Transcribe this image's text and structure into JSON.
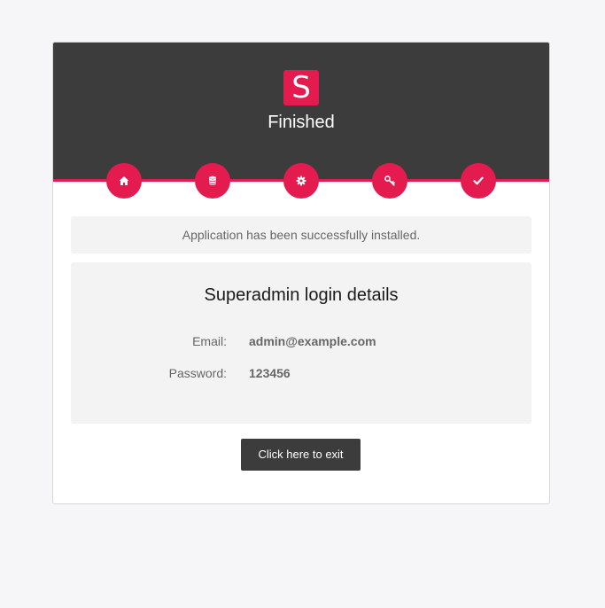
{
  "header": {
    "logo_letter": "S",
    "title": "Finished",
    "accent_color": "#e31b4e",
    "background_color": "#3c3c3c"
  },
  "steps": [
    {
      "icon": "home-icon",
      "completed": true
    },
    {
      "icon": "database-icon",
      "completed": true
    },
    {
      "icon": "gear-icon",
      "completed": true
    },
    {
      "icon": "key-icon",
      "completed": true
    },
    {
      "icon": "check-icon",
      "completed": true
    }
  ],
  "notice": {
    "text": "Application has been successfully installed."
  },
  "login_details": {
    "title": "Superadmin login details",
    "email_label": "Email:",
    "email_value": "admin@example.com",
    "password_label": "Password:",
    "password_value": "123456"
  },
  "exit_button": {
    "label": "Click here to exit"
  }
}
